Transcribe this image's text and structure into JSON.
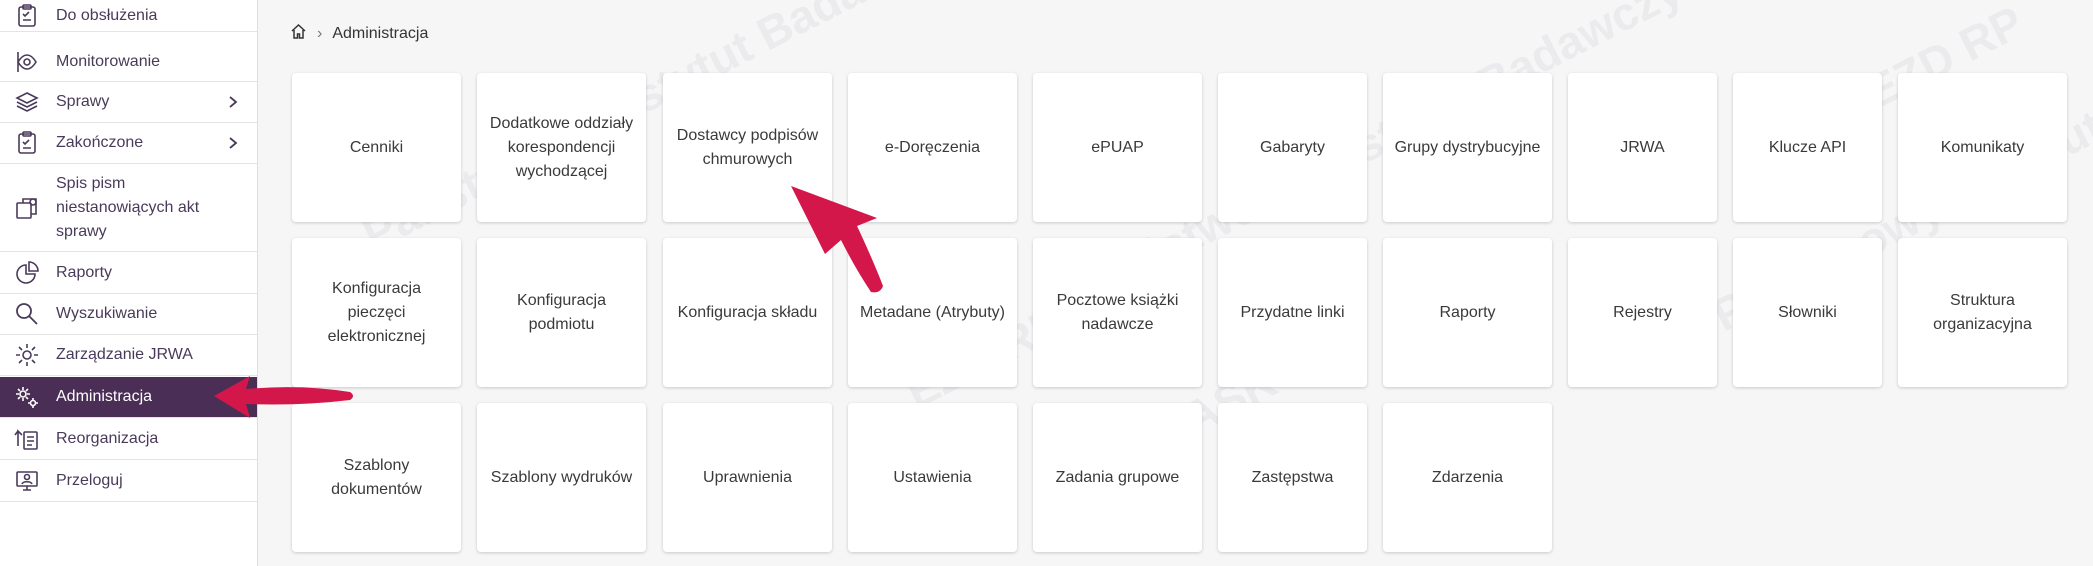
{
  "sidebar": {
    "items": [
      {
        "label": "Do obsłużenia",
        "icon": "clipboard-check-icon"
      },
      {
        "label": "Monitorowanie",
        "icon": "eye-icon"
      },
      {
        "label": "Sprawy",
        "icon": "layers-icon",
        "has_children": true
      },
      {
        "label": "Zakończone",
        "icon": "clipboard-done-icon",
        "has_children": true
      },
      {
        "label": "Spis pism niestanowiących akt sprawy",
        "icon": "documents-icon"
      },
      {
        "label": "Raporty",
        "icon": "pie-chart-icon"
      },
      {
        "label": "Wyszukiwanie",
        "icon": "search-icon"
      },
      {
        "label": "Zarządzanie JRWA",
        "icon": "gear-icon"
      },
      {
        "label": "Administracja",
        "icon": "gears-icon",
        "active": true
      },
      {
        "label": "Reorganizacja",
        "icon": "reorganize-icon"
      },
      {
        "label": "Przeloguj",
        "icon": "switch-user-icon"
      }
    ]
  },
  "breadcrumb": {
    "home_icon": "home-icon",
    "separator": "›",
    "current": "Administracja"
  },
  "tiles": [
    [
      "Cenniki",
      "Dodatkowe oddziały korespondencji wychodzącej",
      "Dostawcy podpisów chmurowych",
      "e-Doręczenia",
      "ePUAP",
      "Gabaryty",
      "Grupy dystrybucyjne",
      "JRWA",
      "Klucze API",
      "Komunikaty"
    ],
    [
      "Konfiguracja pieczęci elektronicznej",
      "Konfiguracja podmiotu",
      "Konfiguracja składu",
      "Metadane (Atrybuty)",
      "Pocztowe książki nadawcze",
      "Przydatne linki",
      "Raporty",
      "Rejestry",
      "Słowniki",
      "Struktura organizacyjna"
    ],
    [
      "Szablony dokumentów",
      "Szablony wydruków",
      "Uprawnienia",
      "Ustawienia",
      "Zadania grupowe",
      "Zastępstwa",
      "Zdarzenia"
    ]
  ],
  "watermark": {
    "lines": [
      "Państwowy Instytut Badawczy",
      "NASK",
      "EZD RP"
    ]
  },
  "colors": {
    "sidebar_active_bg": "#4a2e55",
    "annotation_arrow": "#d4174a",
    "page_bg": "#f6f6f7"
  }
}
